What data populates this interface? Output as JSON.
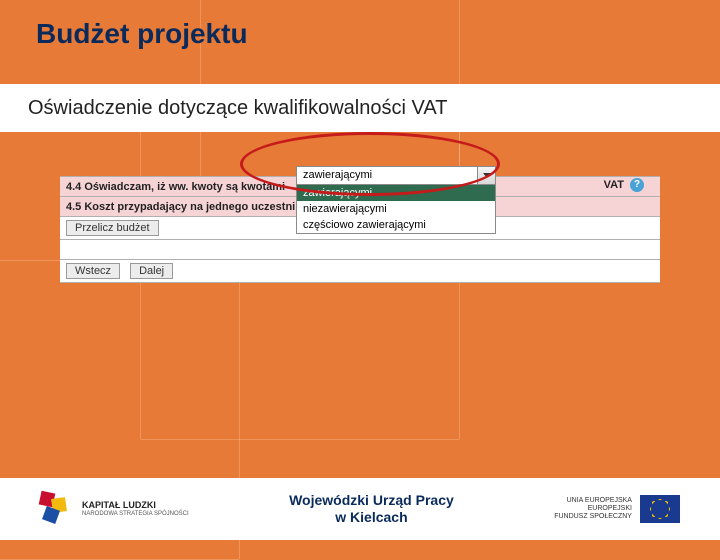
{
  "title": "Budżet projektu",
  "subtitle": "Oświadczenie dotyczące kwalifikowalności VAT",
  "form": {
    "row44": "4.4 Oświadczam, iż ww. kwoty są kwotami",
    "row44_vat": "VAT",
    "row45": "4.5 Koszt przypadający na jednego uczestni",
    "btn_przelicz": "Przelicz budżet",
    "btn_wstecz": "Wstecz",
    "btn_dalej": "Dalej"
  },
  "dropdown": {
    "field_value": "zawierającymi",
    "options": [
      "zawierającymi",
      "niezawierającymi",
      "częściowo zawierającymi"
    ]
  },
  "footer": {
    "kl_line1": "KAPITAŁ LUDZKI",
    "kl_line2": "NARODOWA STRATEGIA SPÓJNOŚCI",
    "center_line1": "Wojewódzki Urząd Pracy",
    "center_line2": "w Kielcach",
    "eu_line1": "UNIA EUROPEJSKA",
    "eu_line2": "EUROPEJSKI",
    "eu_line3": "FUNDUSZ SPOŁECZNY"
  }
}
